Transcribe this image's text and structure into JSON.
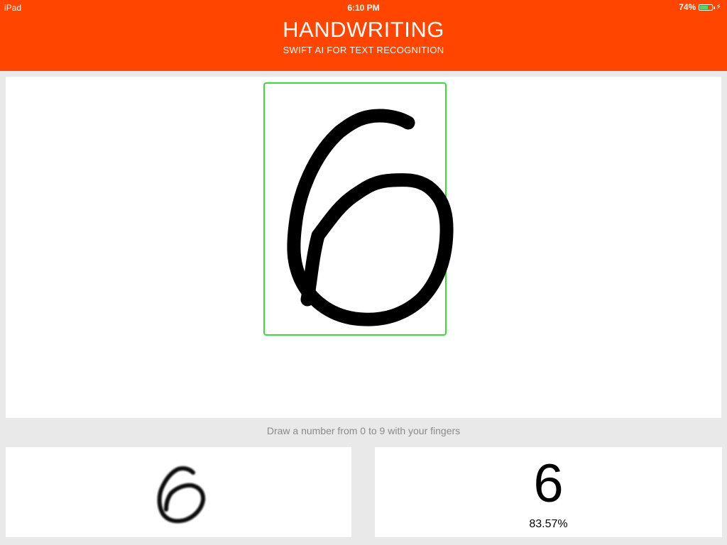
{
  "status_bar": {
    "device": "iPad",
    "time": "6:10 PM",
    "battery": "74%",
    "battery_level": 0.74
  },
  "header": {
    "title": "HANDWRITING",
    "subtitle": "SWIFT AI FOR TEXT RECOGNITION",
    "background_color": "#ff4500"
  },
  "canvas": {
    "stroke_color": "#000000",
    "bounding_box_color": "#33e033"
  },
  "instructions": "Draw a number from 0 to 9 with your fingers",
  "result": {
    "digit": "6",
    "confidence": "83.57%"
  }
}
